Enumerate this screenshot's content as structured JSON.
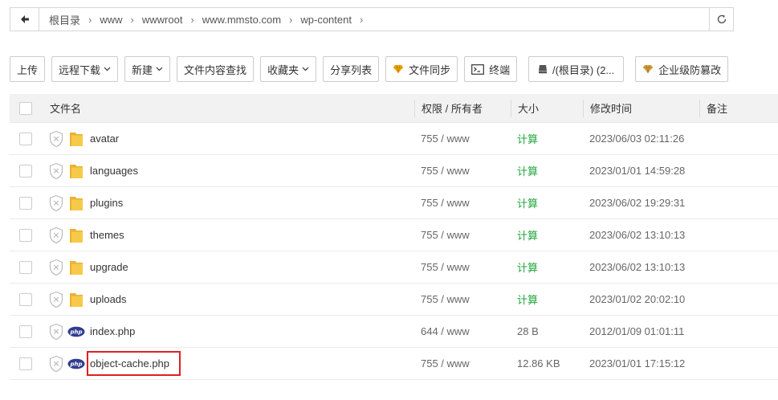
{
  "breadcrumb": [
    "根目录",
    "www",
    "wwwroot",
    "www.mmsto.com",
    "wp-content"
  ],
  "toolbar": {
    "upload": "上传",
    "remote_download": "远程下载",
    "new": "新建",
    "content_search": "文件内容查找",
    "favorites": "收藏夹",
    "share_list": "分享列表",
    "file_sync": "文件同步",
    "terminal": "终端",
    "disk": "/(根目录) (2...",
    "enterprise_protect": "企业级防篡改"
  },
  "columns": {
    "name": "文件名",
    "perm": "权限 / 所有者",
    "size": "大小",
    "mtime": "修改时间",
    "note": "备注"
  },
  "files": [
    {
      "name": "avatar",
      "type": "folder",
      "perm": "755 / www",
      "size": "计算",
      "mtime": "2023/06/03 02:11:26"
    },
    {
      "name": "languages",
      "type": "folder",
      "perm": "755 / www",
      "size": "计算",
      "mtime": "2023/01/01 14:59:28"
    },
    {
      "name": "plugins",
      "type": "folder",
      "perm": "755 / www",
      "size": "计算",
      "mtime": "2023/06/02 19:29:31"
    },
    {
      "name": "themes",
      "type": "folder",
      "perm": "755 / www",
      "size": "计算",
      "mtime": "2023/06/02 13:10:13"
    },
    {
      "name": "upgrade",
      "type": "folder",
      "perm": "755 / www",
      "size": "计算",
      "mtime": "2023/06/02 13:10:13"
    },
    {
      "name": "uploads",
      "type": "folder",
      "perm": "755 / www",
      "size": "计算",
      "mtime": "2023/01/02 20:02:10"
    },
    {
      "name": "index.php",
      "type": "php",
      "perm": "644 / www",
      "size": "28 B",
      "mtime": "2012/01/09 01:01:11"
    },
    {
      "name": "object-cache.php",
      "type": "php",
      "perm": "755 / www",
      "size": "12.86 KB",
      "mtime": "2023/01/01 17:15:12",
      "highlighted": true
    }
  ],
  "colors": {
    "calc_green": "#20a53a",
    "folder_yellow": "#f5c33b",
    "php_blue": "#2f3d8f",
    "highlight_red": "#e02020"
  }
}
